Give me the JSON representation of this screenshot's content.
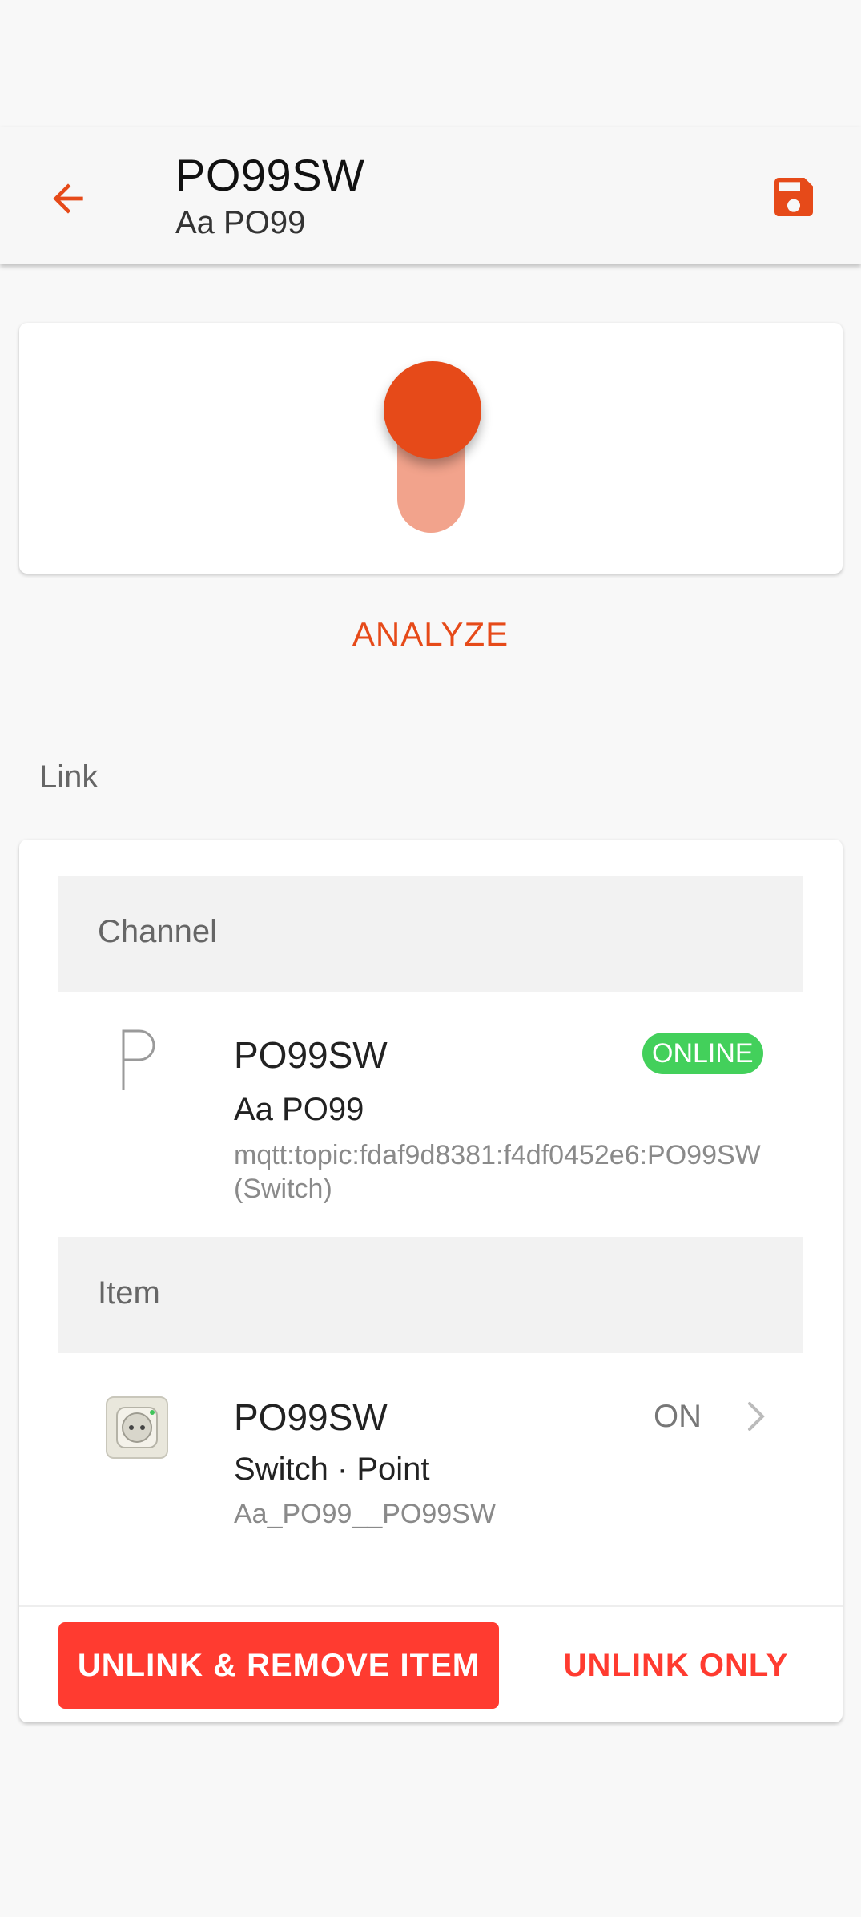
{
  "header": {
    "title": "PO99SW",
    "subtitle": "Aa PO99",
    "back_icon": "arrow-left-icon",
    "save_icon": "floppy-disk-icon"
  },
  "toggle": {
    "state": "on"
  },
  "analyze_label": "ANALYZE",
  "link_section": {
    "label": "Link",
    "channel": {
      "header": "Channel",
      "title": "PO99SW",
      "subtitle": "Aa PO99",
      "uid": "mqtt:topic:fdaf9d8381:f4df0452e6:PO99SW",
      "type": "(Switch)",
      "status": "ONLINE",
      "icon": "letter-p-icon"
    },
    "item": {
      "header": "Item",
      "title": "PO99SW",
      "subtitle": "Switch · Point",
      "name": "Aa_PO99__PO99SW",
      "state": "ON",
      "icon": "power-outlet-icon"
    },
    "buttons": {
      "unlink_remove": "UNLINK & REMOVE ITEM",
      "unlink_only": "UNLINK ONLY"
    }
  },
  "colors": {
    "accent": "#e64a19",
    "danger": "#ff3b30",
    "online": "#43d05b"
  }
}
